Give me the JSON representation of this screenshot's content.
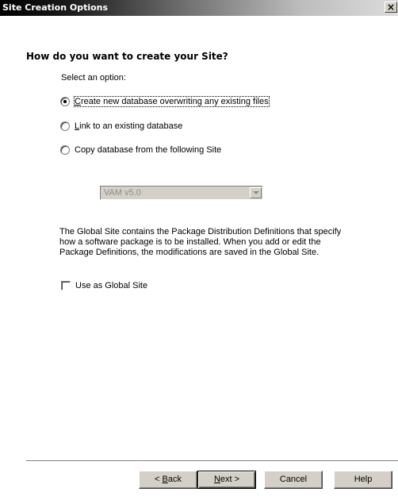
{
  "window": {
    "title": "Site Creation Options",
    "close_glyph": "×"
  },
  "content": {
    "heading": "How do you want to create your Site?",
    "prompt": "Select an option:",
    "options": [
      {
        "pre": "",
        "mnemonic": "C",
        "post": "reate new database overwriting any existing files",
        "checked": true
      },
      {
        "pre": "",
        "mnemonic": "L",
        "post": "ink to an existing database",
        "checked": false
      },
      {
        "pre": "Copy database from the following Site",
        "mnemonic": "",
        "post": "",
        "checked": false
      }
    ],
    "site_select": {
      "value": "VAM v5.0",
      "enabled": false
    },
    "info_lines": [
      "The Global Site contains the Package Distribution Definitions that specify",
      "how a software package is to be installed. When you add or edit the",
      "Package Definitions, the modifications are saved in the Global Site."
    ],
    "global_site_checkbox": {
      "label": "Use as Global Site",
      "checked": false
    }
  },
  "buttons": {
    "back": {
      "pre": "< ",
      "mnemonic": "B",
      "post": "ack"
    },
    "next": {
      "pre": "",
      "mnemonic": "N",
      "post": "ext >"
    },
    "cancel": "Cancel",
    "help": "Help"
  },
  "colors": {
    "dialog_face": "#d4d0c8",
    "title_text": "#ffffff",
    "disabled_text": "#8c8c8c"
  }
}
